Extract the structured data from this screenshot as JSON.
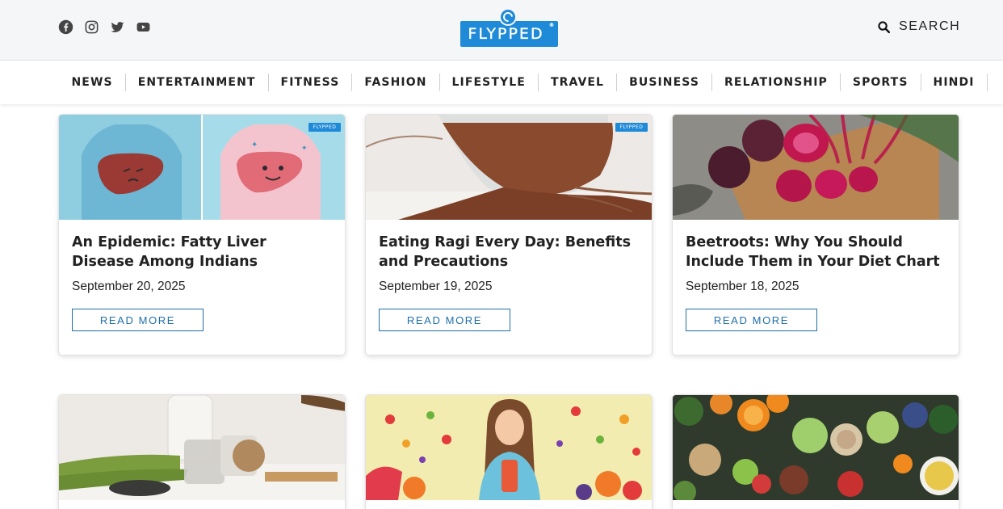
{
  "header": {
    "logo_text": "FLYPPED",
    "logo_tm": "®",
    "search_label": "SEARCH",
    "socials": [
      {
        "name": "facebook-icon"
      },
      {
        "name": "instagram-icon"
      },
      {
        "name": "twitter-icon"
      },
      {
        "name": "youtube-icon"
      }
    ]
  },
  "nav": {
    "items": [
      "NEWS",
      "ENTERTAINMENT",
      "FITNESS",
      "FASHION",
      "LIFESTYLE",
      "TRAVEL",
      "BUSINESS",
      "RELATIONSHIP",
      "SPORTS",
      "HINDI"
    ]
  },
  "articles": [
    {
      "title": "An Epidemic: Fatty Liver Disease Among Indians",
      "date": "September 20, 2025",
      "read_more": "READ MORE",
      "badge": "FLYPPED"
    },
    {
      "title": "Eating Ragi Every Day: Benefits and Precautions",
      "date": "September 19, 2025",
      "read_more": "READ MORE",
      "badge": "FLYPPED"
    },
    {
      "title": "Beetroots: Why You Should Include Them in Your Diet Chart",
      "date": "September 18, 2025",
      "read_more": "READ MORE"
    },
    {
      "title": "",
      "date": ""
    },
    {
      "title": "",
      "date": ""
    },
    {
      "title": "",
      "date": ""
    }
  ],
  "colors": {
    "brand": "#1f8ad8",
    "button": "#1f6fa8",
    "header_bg": "#f5f6f8"
  }
}
